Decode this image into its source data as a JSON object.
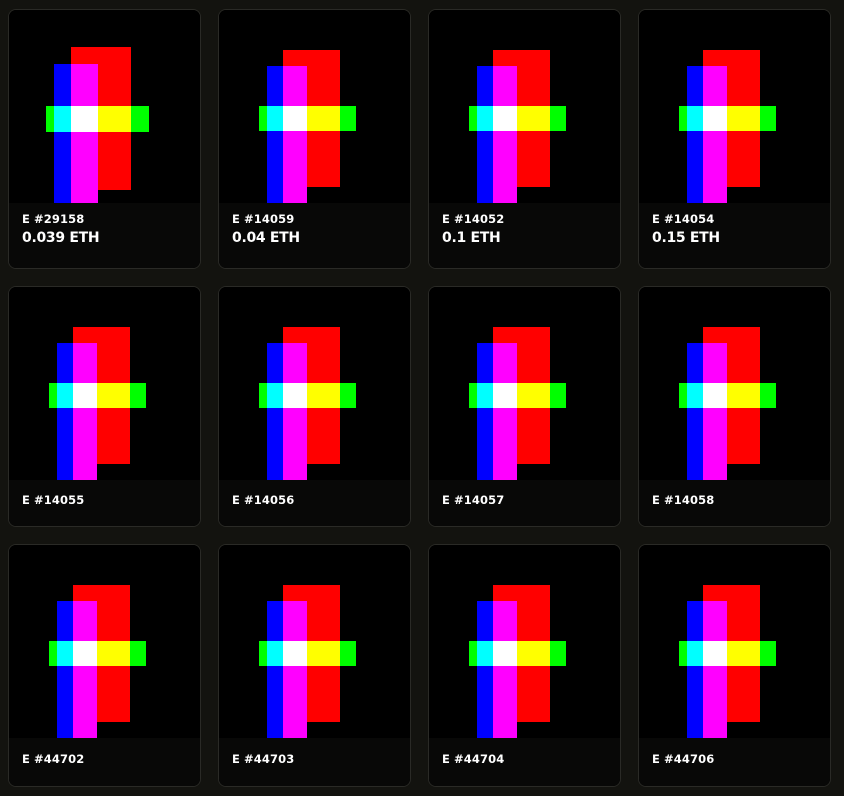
{
  "colors": {
    "page_background": "#13130f",
    "card_background": "#000000",
    "card_border": "#2a2a26",
    "art_red": "#ff0000",
    "art_blue": "#0000ff",
    "art_magenta": "#ff00ff",
    "art_green": "#00ff00",
    "art_cyan": "#00ffff",
    "art_white": "#ffffff",
    "art_yellow": "#ffff00"
  },
  "cards": [
    {
      "name": "E #29158",
      "price": "0.039 ETH"
    },
    {
      "name": "E #14059",
      "price": "0.04 ETH"
    },
    {
      "name": "E #14052",
      "price": "0.1 ETH"
    },
    {
      "name": "E #14054",
      "price": "0.15 ETH"
    },
    {
      "name": "E #14055"
    },
    {
      "name": "E #14056"
    },
    {
      "name": "E #14057"
    },
    {
      "name": "E #14058"
    },
    {
      "name": "E #44702"
    },
    {
      "name": "E #44703"
    },
    {
      "name": "E #44704"
    },
    {
      "name": "E #44706"
    }
  ]
}
